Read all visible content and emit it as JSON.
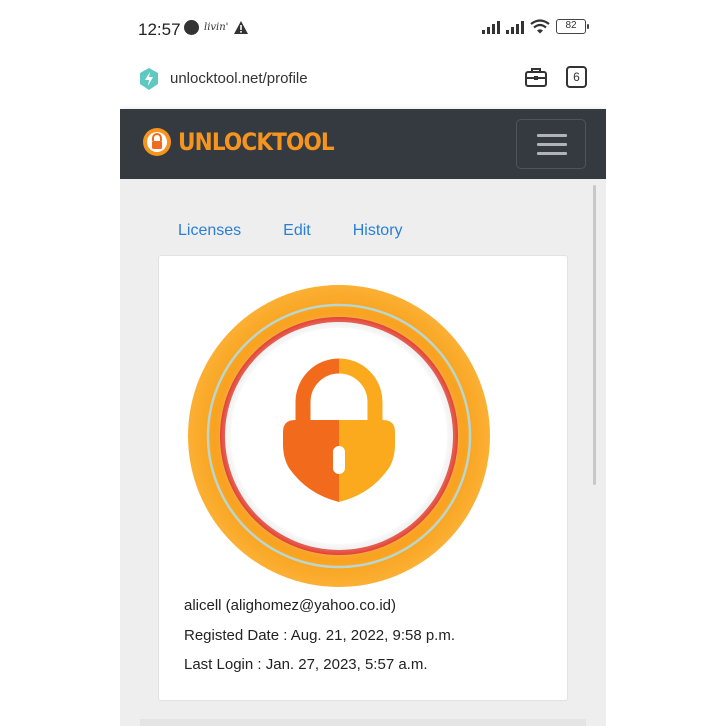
{
  "status_bar": {
    "time": "12:57",
    "brand_mini": "livin'",
    "battery": "82"
  },
  "address_bar": {
    "url": "unlocktool.net/profile",
    "tab_count": "6"
  },
  "site_header": {
    "logo_text": "UNLOCKTOOL",
    "menu_icon": "hamburger-icon"
  },
  "tabs": [
    {
      "label": "Licenses"
    },
    {
      "label": "Edit"
    },
    {
      "label": "History"
    }
  ],
  "profile": {
    "user_line": "alicell (alighomez@yahoo.co.id)",
    "registered_line": "Registed Date : Aug. 21, 2022, 9:58 p.m.",
    "last_login_line": "Last Login : Jan. 27, 2023, 5:57 a.m."
  },
  "colors": {
    "header_bg": "#343a40",
    "accent_orange": "#f7941d",
    "link_blue": "#2a7fd4",
    "content_bg": "#eeeeee"
  }
}
